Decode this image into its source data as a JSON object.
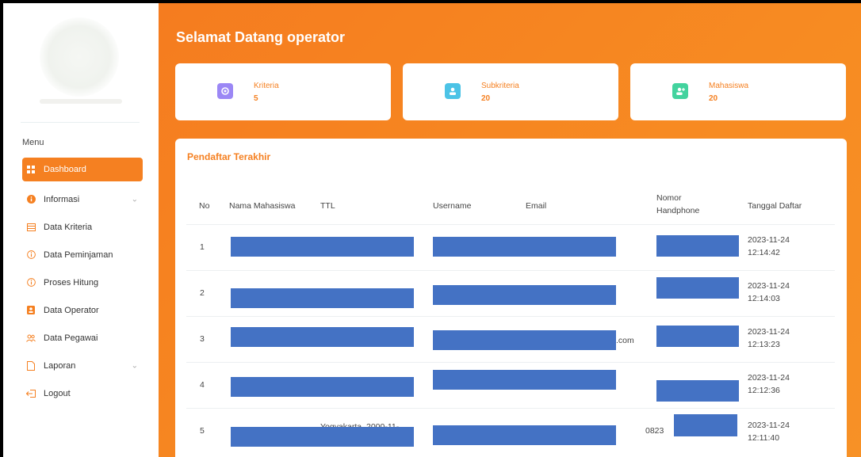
{
  "sidebar": {
    "menu_title": "Menu",
    "items": [
      {
        "label": "Dashboard",
        "icon": "grid-icon",
        "active": true,
        "chevron": false
      },
      {
        "label": "Informasi",
        "icon": "info-icon",
        "active": false,
        "chevron": true
      },
      {
        "label": "Data Kriteria",
        "icon": "table-icon",
        "active": false,
        "chevron": false
      },
      {
        "label": "Data Peminjaman",
        "icon": "info-circle-icon",
        "active": false,
        "chevron": false
      },
      {
        "label": "Proses Hitung",
        "icon": "info-circle-icon",
        "active": false,
        "chevron": false
      },
      {
        "label": "Data Operator",
        "icon": "id-card-icon",
        "active": false,
        "chevron": false
      },
      {
        "label": "Data Pegawai",
        "icon": "users-icon",
        "active": false,
        "chevron": false
      },
      {
        "label": "Laporan",
        "icon": "file-icon",
        "active": false,
        "chevron": true
      },
      {
        "label": "Logout",
        "icon": "logout-icon",
        "active": false,
        "chevron": false
      }
    ]
  },
  "header": {
    "welcome": "Selamat Datang operator"
  },
  "stats": [
    {
      "label": "Kriteria",
      "value": "5",
      "icon": "eye-icon",
      "color": "#9b87f5"
    },
    {
      "label": "Subkriteria",
      "value": "20",
      "icon": "user-icon",
      "color": "#4cc3e6"
    },
    {
      "label": "Mahasiswa",
      "value": "20",
      "icon": "user-plus-icon",
      "color": "#43d39e"
    }
  ],
  "table": {
    "title": "Pendaftar Terakhir",
    "headers": {
      "no": "No",
      "nama": "Nama Mahasiswa",
      "ttl": "TTL",
      "username": "Username",
      "email": "Email",
      "hp_line1": "Nomor",
      "hp_line2": "Handphone",
      "tanggal": "Tanggal Daftar"
    },
    "rows": [
      {
        "no": "1",
        "date": "2023-11-24",
        "time": "12:14:42",
        "ttl_visible": "",
        "email_visible": "",
        "hp_visible": ""
      },
      {
        "no": "2",
        "date": "2023-11-24",
        "time": "12:14:03",
        "ttl_visible": "",
        "email_visible": "",
        "hp_visible": ""
      },
      {
        "no": "3",
        "date": "2023-11-24",
        "time": "12:13:23",
        "ttl_visible": "",
        "email_visible": ".com",
        "hp_visible": ""
      },
      {
        "no": "4",
        "date": "2023-11-24",
        "time": "12:12:36",
        "ttl_visible": "",
        "email_visible": "",
        "hp_visible": ""
      },
      {
        "no": "5",
        "date": "2023-11-24",
        "time": "12:11:40",
        "ttl_visible": "Yogyakarta, 2000-11-",
        "email_visible": "",
        "hp_visible": "0823"
      }
    ],
    "redaction_color": "#4472c4"
  },
  "colors": {
    "accent": "#f58021",
    "background_gradient_start": "#f57c1f"
  }
}
